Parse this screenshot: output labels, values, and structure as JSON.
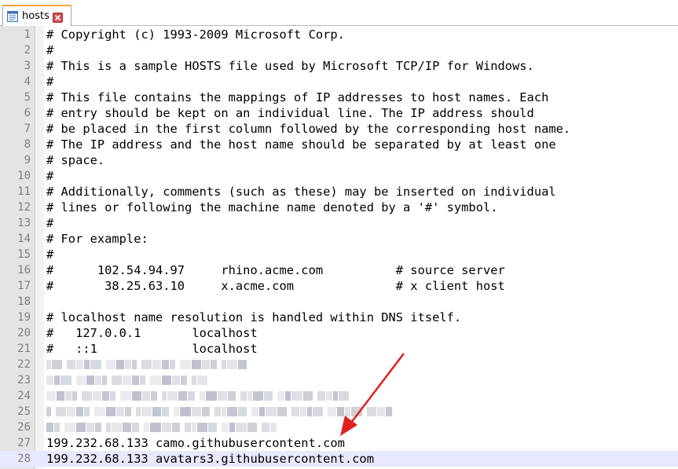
{
  "tab": {
    "label": "hosts",
    "file_icon": "file-icon",
    "close_icon": "close-icon"
  },
  "lines": [
    {
      "num": "1",
      "text": "# Copyright (c) 1993-2009 Microsoft Corp."
    },
    {
      "num": "2",
      "text": "#"
    },
    {
      "num": "3",
      "text": "# This is a sample HOSTS file used by Microsoft TCP/IP for Windows."
    },
    {
      "num": "4",
      "text": "#"
    },
    {
      "num": "5",
      "text": "# This file contains the mappings of IP addresses to host names. Each"
    },
    {
      "num": "6",
      "text": "# entry should be kept on an individual line. The IP address should"
    },
    {
      "num": "7",
      "text": "# be placed in the first column followed by the corresponding host name."
    },
    {
      "num": "8",
      "text": "# The IP address and the host name should be separated by at least one"
    },
    {
      "num": "9",
      "text": "# space."
    },
    {
      "num": "10",
      "text": "#"
    },
    {
      "num": "11",
      "text": "# Additionally, comments (such as these) may be inserted on individual"
    },
    {
      "num": "12",
      "text": "# lines or following the machine name denoted by a '#' symbol."
    },
    {
      "num": "13",
      "text": "#"
    },
    {
      "num": "14",
      "text": "# For example:"
    },
    {
      "num": "15",
      "text": "#"
    },
    {
      "num": "16",
      "text": "#      102.54.94.97     rhino.acme.com          # source server"
    },
    {
      "num": "17",
      "text": "#       38.25.63.10     x.acme.com              # x client host"
    },
    {
      "num": "18",
      "text": ""
    },
    {
      "num": "19",
      "text": "# localhost name resolution is handled within DNS itself."
    },
    {
      "num": "20",
      "text": "#   127.0.0.1       localhost"
    },
    {
      "num": "21",
      "text": "#   ::1             localhost"
    },
    {
      "num": "22",
      "text": ""
    },
    {
      "num": "23",
      "text": ""
    },
    {
      "num": "24",
      "text": ""
    },
    {
      "num": "25",
      "text": ""
    },
    {
      "num": "26",
      "text": ""
    },
    {
      "num": "27",
      "text": "199.232.68.133 camo.githubusercontent.com"
    },
    {
      "num": "28",
      "text": "199.232.68.133 avatars3.githubusercontent.com"
    }
  ],
  "redacted_lines": [
    "22",
    "23",
    "24",
    "25",
    "26"
  ],
  "current_line": "28",
  "colors": {
    "gutter_bg": "#e4e4e4",
    "line_number": "#808080",
    "current_line_bg": "#e8e8ff",
    "tab_accent": "#f9a23a",
    "annotation_arrow": "#e02020",
    "close_icon": "#d14c4c"
  },
  "annotation": {
    "arrow_icon": "red-arrow-annotation"
  }
}
